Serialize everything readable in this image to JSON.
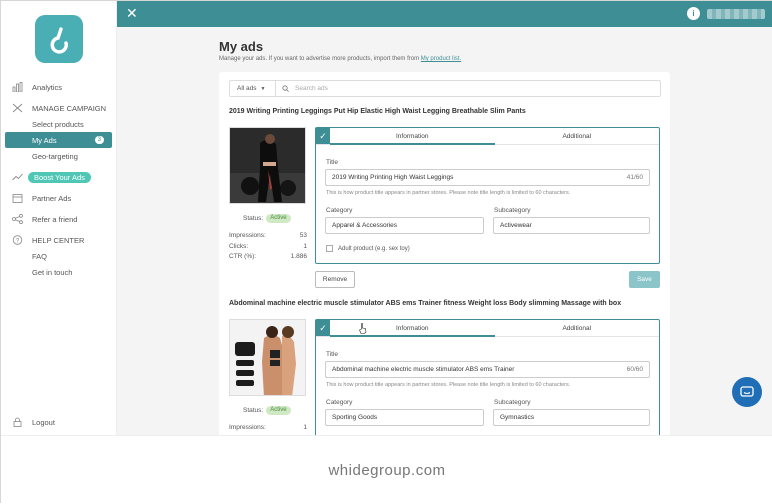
{
  "topbar": {
    "close": "✕",
    "info": "i"
  },
  "sidebar": {
    "items": [
      {
        "label": "Analytics",
        "icon": "bar-chart-icon"
      },
      {
        "label": "MANAGE CAMPAIGN",
        "icon": "tools-icon"
      },
      {
        "label": "Select products"
      },
      {
        "label": "My Ads",
        "count": "3",
        "active": true
      },
      {
        "label": "Geo-targeting"
      },
      {
        "label": "Boost Your Ads",
        "icon": "trend-icon"
      },
      {
        "label": "Partner Ads",
        "icon": "calendar-icon"
      },
      {
        "label": "Refer a friend",
        "icon": "share-icon"
      },
      {
        "label": "HELP CENTER",
        "icon": "help-icon"
      },
      {
        "label": "FAQ"
      },
      {
        "label": "Get in touch"
      }
    ],
    "logout": "Logout"
  },
  "page": {
    "title": "My ads",
    "subtitle": "Manage your ads. If you want to advertise more products, import them from ",
    "subtitle_link": "My product list."
  },
  "filter": {
    "select": "All ads",
    "search_placeholder": "Search ads"
  },
  "ads": [
    {
      "title": "2019 Writing Printing Leggings Put Hip Elastic High Waist Legging Breathable Slim Pants",
      "status_label": "Status:",
      "status": "Active",
      "impressions_label": "Impressions:",
      "impressions": "53",
      "clicks_label": "Clicks:",
      "clicks": "1",
      "ctr_label": "CTR (%):",
      "ctr": "1.886",
      "tab_info": "Information",
      "tab_additional": "Additional",
      "field_title_label": "Title",
      "field_title": "2019 Writing Printing High Waist Leggings",
      "field_title_count": "41/60",
      "help": "This is how product title appears in partner stores. Please note title length is limited to 60 characters.",
      "category_label": "Category",
      "category": "Apparel & Accessories",
      "subcategory_label": "Subcategory",
      "subcategory": "Activewear",
      "adult_label": "Adult product (e.g. sex toy)",
      "remove": "Remove",
      "save": "Save"
    },
    {
      "title": "Abdominal machine electric muscle stimulator ABS ems Trainer fitness Weight loss Body slimming Massage with box",
      "status_label": "Status:",
      "status": "Active",
      "impressions_label": "Impressions:",
      "impressions": "1",
      "tab_info": "Information",
      "tab_additional": "Additional",
      "field_title_label": "Title",
      "field_title": "Abdominal machine electric muscle stimulator ABS ems Trainer",
      "field_title_count": "60/60",
      "help": "This is how product title appears in partner stores. Please note title length is limited to 60 characters.",
      "category_label": "Category",
      "category": "Sporting Goods",
      "subcategory_label": "Subcategory",
      "subcategory": "Gymnastics"
    }
  ],
  "footer": "whidegroup.com",
  "colors": {
    "accent": "#3d8f95",
    "boost": "#4fc6b6",
    "chat": "#1f6eb6"
  }
}
